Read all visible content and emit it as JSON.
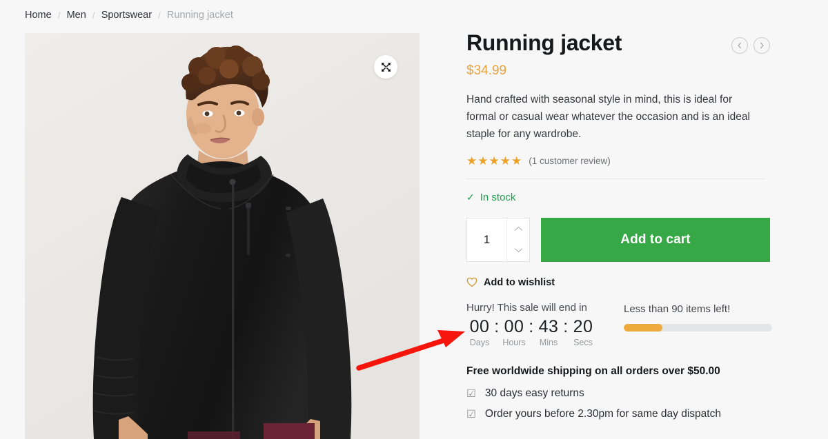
{
  "breadcrumb": {
    "items": [
      {
        "label": "Home",
        "current": false
      },
      {
        "label": "Men",
        "current": false
      },
      {
        "label": "Sportswear",
        "current": false
      },
      {
        "label": "Running jacket",
        "current": true
      }
    ],
    "separator": "/"
  },
  "gallery": {
    "expand_icon": "expand-arrows-icon",
    "alt": "Male model wearing a black zip-up running jacket"
  },
  "product": {
    "title": "Running jacket",
    "price": "$34.99",
    "description": "Hand crafted with seasonal style in mind, this is ideal for formal or casual wear whatever the occasion and is an ideal staple for any wardrobe.",
    "rating": 5,
    "star_glyph": "★",
    "review_count_label": "(1 customer review)",
    "stock_status": "In stock",
    "stock_check_glyph": "✓"
  },
  "nav": {
    "prev_icon": "chevron-left-icon",
    "next_icon": "chevron-right-icon"
  },
  "purchase": {
    "quantity_value": "1",
    "quantity_up_icon": "chevron-up-icon",
    "quantity_down_icon": "chevron-down-icon",
    "add_to_cart_label": "Add to cart",
    "wishlist_label": "Add to wishlist",
    "wishlist_icon": "heart-outline-icon"
  },
  "urgency": {
    "hurry_label": "Hurry! This sale will end in",
    "timer": {
      "days": "00",
      "hours": "00",
      "mins": "43",
      "secs": "20",
      "colon": ":",
      "labels": {
        "days": "Days",
        "hours": "Hours",
        "mins": "Mins",
        "secs": "Secs"
      }
    },
    "items_left_label": "Less than 90 items left!",
    "progress_percent": 26
  },
  "shipping": {
    "headline": "Free worldwide shipping on all orders over $50.00",
    "perk_icon_glyph": "☑",
    "perks": [
      "30 days easy returns",
      "Order yours before 2.30pm for same day dispatch"
    ]
  },
  "annotation": {
    "type": "arrow",
    "color": "#f5150b",
    "points_to": "countdown-timer"
  },
  "colors": {
    "page_background": "#f7f7f7",
    "accent_price": "#e8a33d",
    "accent_star": "#eda026",
    "cart_green": "#36a846",
    "stock_green": "#1f9d4d",
    "progress_orange": "#efaa3e",
    "annotation_red": "#f5150b"
  }
}
